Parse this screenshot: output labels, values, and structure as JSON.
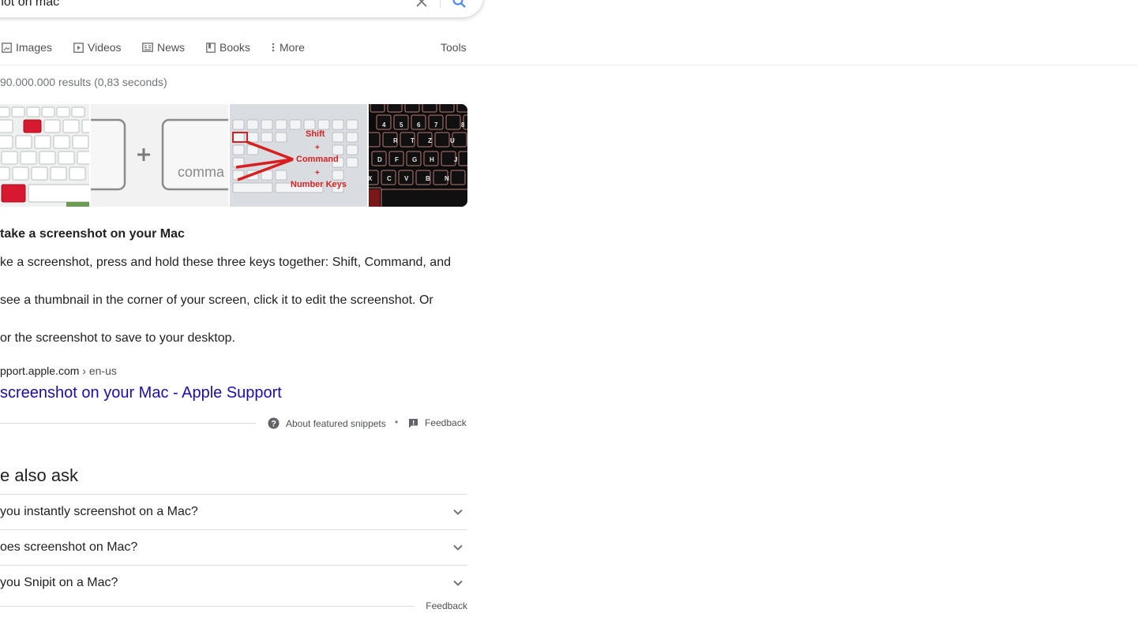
{
  "search": {
    "query": "hot on mac"
  },
  "tabs": [
    {
      "label": "Images",
      "icon": "image-icon"
    },
    {
      "label": "Videos",
      "icon": "play-icon"
    },
    {
      "label": "News",
      "icon": "news-icon"
    },
    {
      "label": "Books",
      "icon": "book-icon"
    },
    {
      "label": "More",
      "icon": "more-vert-icon"
    }
  ],
  "tools_label": "Tools",
  "stats": "90.000.000 results (0,83 seconds)",
  "images": [
    {
      "name": "keyboard-highlight-image",
      "caption": ""
    },
    {
      "name": "key-combo-image",
      "plus": "+",
      "key_label": "comma"
    },
    {
      "name": "shift-command-number-image",
      "labels": [
        "Shift",
        "+",
        "Command",
        "+",
        "Number Keys"
      ]
    },
    {
      "name": "black-keyboard-image",
      "keys_row1": [
        "4",
        "5",
        "6",
        "7",
        "8"
      ],
      "keys_row2": [
        "R",
        "T",
        "Z",
        "U"
      ],
      "keys_row3": [
        "D",
        "F",
        "G",
        "H",
        "J"
      ],
      "keys_row4": [
        "X",
        "C",
        "V",
        "B",
        "N"
      ]
    }
  ],
  "snippet": {
    "title": "take a screenshot on your Mac",
    "para1": "ke a screenshot, press and hold these three keys together: Shift, Command, and",
    "para2_line1": " see a thumbnail in the corner of your screen, click it to edit the screenshot. Or",
    "para2_line2": "or the screenshot to save to your desktop."
  },
  "result": {
    "site": "pport.apple.com",
    "path": " › en-us",
    "title": " screenshot on your Mac - Apple Support"
  },
  "about": {
    "about_label": "About featured snippets",
    "separator": "•",
    "feedback_label": "Feedback"
  },
  "paa": {
    "title": "e also ask",
    "questions": [
      "you instantly screenshot on a Mac?",
      "oes screenshot on Mac?",
      "you Snipit on a Mac?"
    ],
    "feedback_label": "Feedback"
  },
  "colors": {
    "link": "#1a0dab",
    "search_blue": "#4285f4",
    "secondary_text": "#4d5156"
  }
}
